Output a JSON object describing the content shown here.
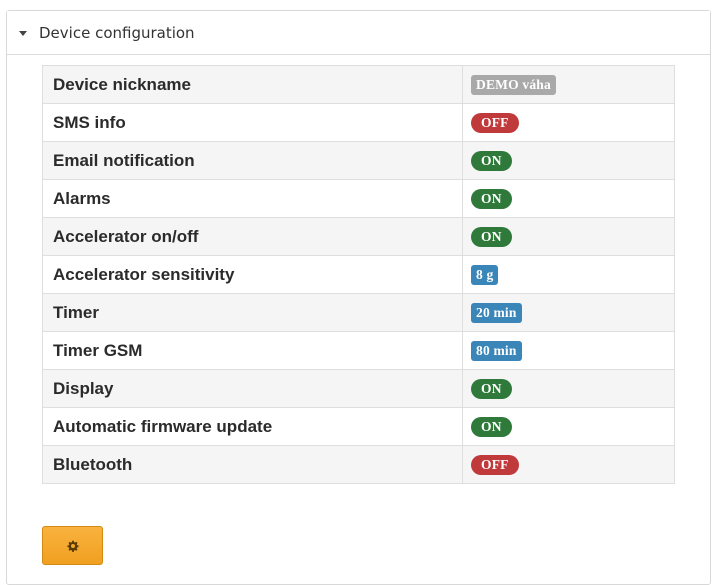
{
  "panel": {
    "title": "Device configuration"
  },
  "rows": [
    {
      "label": "Device nickname",
      "value": "DEMO váha",
      "style": "gray"
    },
    {
      "label": "SMS info",
      "value": "OFF",
      "style": "off"
    },
    {
      "label": "Email notification",
      "value": "ON",
      "style": "on"
    },
    {
      "label": "Alarms",
      "value": "ON",
      "style": "on"
    },
    {
      "label": "Accelerator on/off",
      "value": "ON",
      "style": "on"
    },
    {
      "label": "Accelerator sensitivity",
      "value": "8 g",
      "style": "blue"
    },
    {
      "label": "Timer",
      "value": "20 min",
      "style": "blue"
    },
    {
      "label": "Timer GSM",
      "value": "80 min",
      "style": "blue"
    },
    {
      "label": "Display",
      "value": "ON",
      "style": "on"
    },
    {
      "label": "Automatic firmware update",
      "value": "ON",
      "style": "on"
    },
    {
      "label": "Bluetooth",
      "value": "OFF",
      "style": "off"
    }
  ],
  "icons": {
    "collapse": "caret-down-icon",
    "settings": "gear-icon"
  },
  "colors": {
    "on": "#2f7a3a",
    "off": "#c0393b",
    "nickname": "#a9a9a9",
    "numeric": "#3a86b8",
    "settings_button": "#f0a020"
  }
}
